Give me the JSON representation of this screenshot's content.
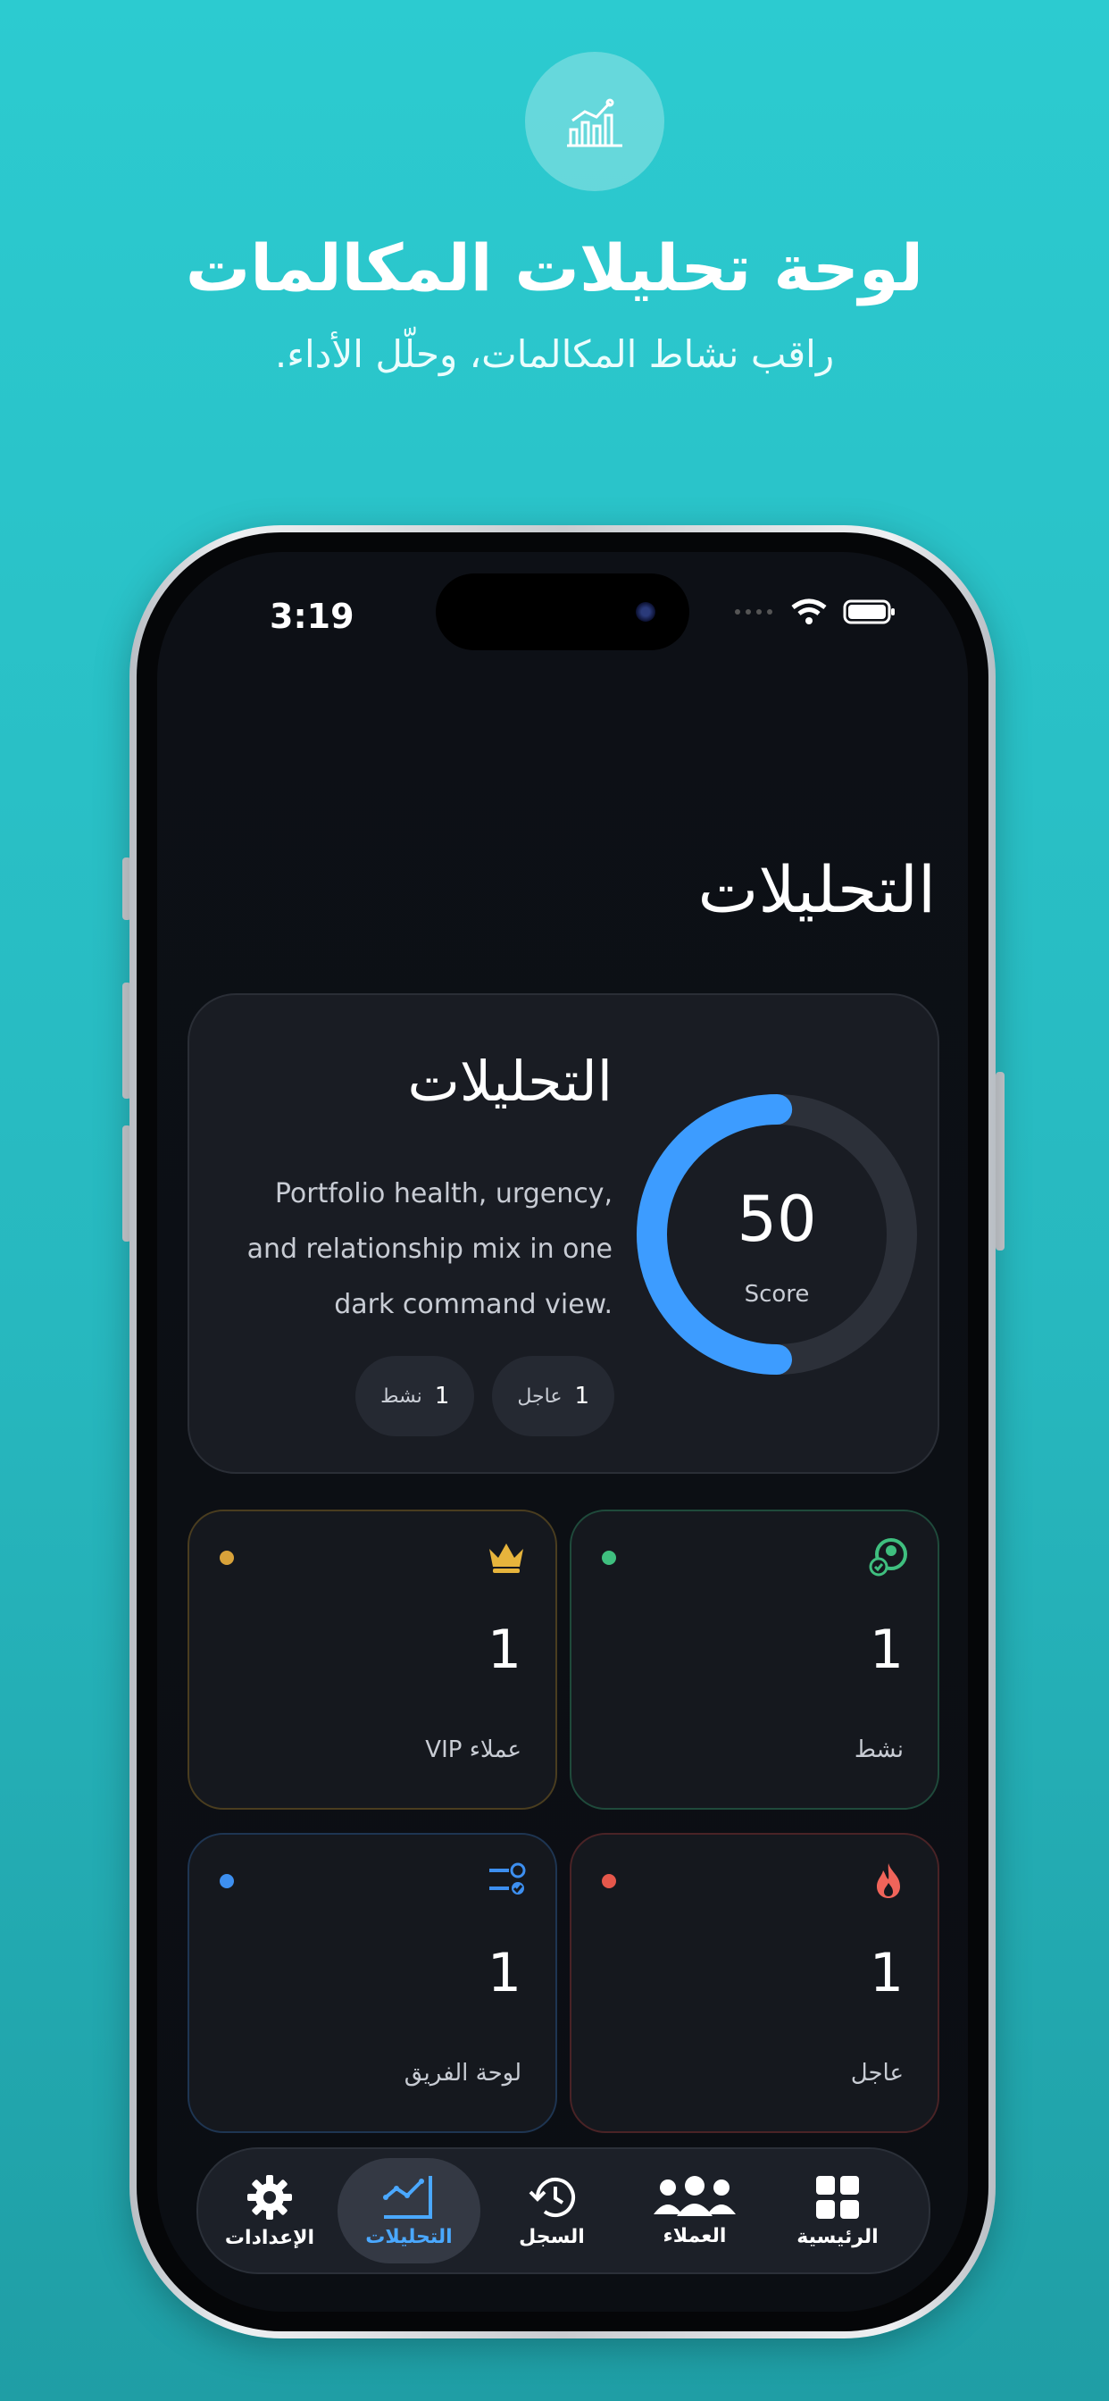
{
  "promo": {
    "headline": "لوحة تحليلات المكالمات",
    "subline": "راقب نشاط المكالمات، وحلّل الأداء."
  },
  "status_bar": {
    "time": "3:19"
  },
  "page": {
    "title": "التحليلات"
  },
  "hero": {
    "title": "التحليلات",
    "description": "Portfolio health, urgency, and relationship mix in one dark command view.",
    "score_value": "50",
    "score_label": "Score",
    "score_fraction": 0.5,
    "chips": [
      {
        "label": "نشط",
        "value": "1"
      },
      {
        "label": "عاجل",
        "value": "1"
      }
    ]
  },
  "stats": [
    {
      "label": "نشط",
      "value": "1",
      "color": "#3fbf7f",
      "icon": "active-user-icon"
    },
    {
      "label": "عملاء VIP",
      "value": "1",
      "color": "#d8a23a",
      "icon": "crown-icon"
    },
    {
      "label": "عاجل",
      "value": "1",
      "color": "#e5574b",
      "icon": "flame-icon"
    },
    {
      "label": "لوحة الفريق",
      "value": "1",
      "color": "#3d8ff0",
      "icon": "checklist-icon"
    }
  ],
  "tabs": [
    {
      "label": "الرئيسية",
      "icon": "grid-icon"
    },
    {
      "label": "العملاء",
      "icon": "people-icon"
    },
    {
      "label": "السجل",
      "icon": "history-icon"
    },
    {
      "label": "التحليلات",
      "icon": "analytics-icon",
      "active": true
    },
    {
      "label": "الإعدادات",
      "icon": "gear-icon"
    }
  ],
  "colors": {
    "accent": "#3d9cff",
    "background": "#0b0e13",
    "promo_bg": "#2ccbd0"
  }
}
